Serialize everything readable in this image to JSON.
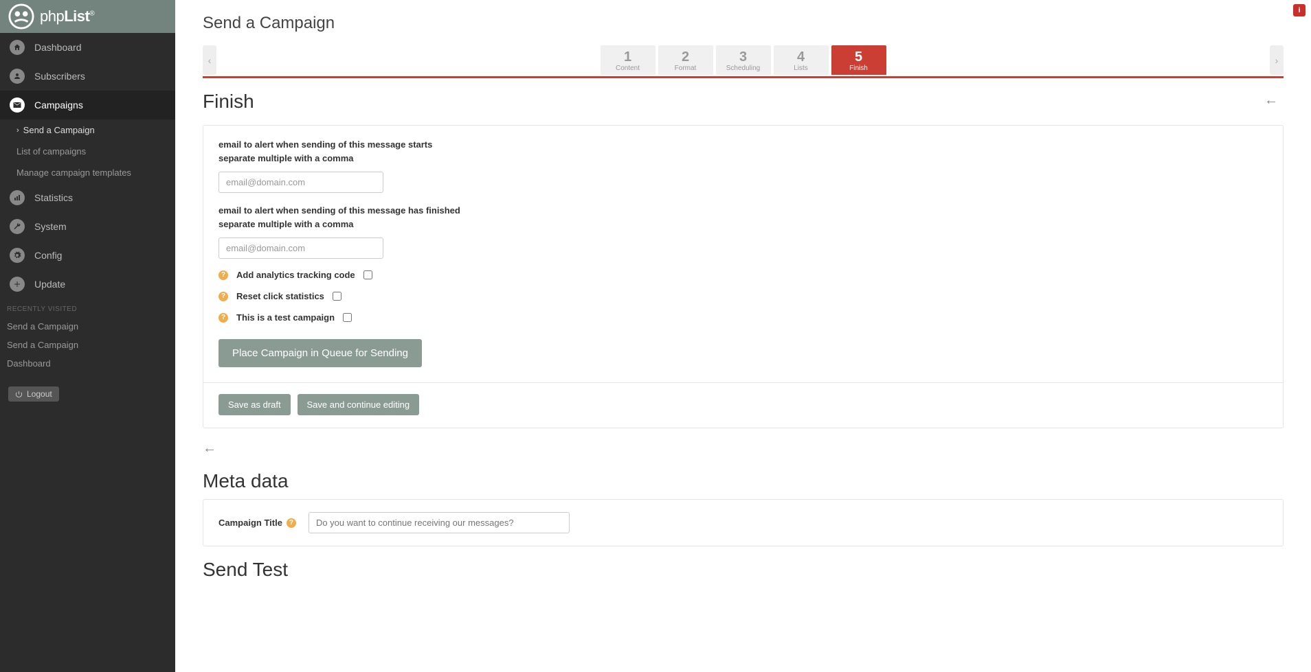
{
  "brand": {
    "name_light": "php",
    "name_bold": "List",
    "reg": "®"
  },
  "infoBadge": "i",
  "sidebar": {
    "items": [
      {
        "label": "Dashboard",
        "icon": "home"
      },
      {
        "label": "Subscribers",
        "icon": "user"
      },
      {
        "label": "Campaigns",
        "icon": "envelope"
      },
      {
        "label": "Statistics",
        "icon": "chart"
      },
      {
        "label": "System",
        "icon": "wrench"
      },
      {
        "label": "Config",
        "icon": "gear"
      },
      {
        "label": "Update",
        "icon": "plus"
      }
    ],
    "sub": [
      {
        "label": "Send a Campaign"
      },
      {
        "label": "List of campaigns"
      },
      {
        "label": "Manage campaign templates"
      }
    ],
    "recentTitle": "RECENTLY VISITED",
    "recent": [
      {
        "label": "Send a Campaign"
      },
      {
        "label": "Send a Campaign"
      },
      {
        "label": "Dashboard"
      }
    ],
    "logout": "Logout"
  },
  "page": {
    "title": "Send a Campaign",
    "wizard": {
      "prev": "‹",
      "next": "›",
      "tabs": [
        {
          "num": "1",
          "label": "Content"
        },
        {
          "num": "2",
          "label": "Format"
        },
        {
          "num": "3",
          "label": "Scheduling"
        },
        {
          "num": "4",
          "label": "Lists"
        },
        {
          "num": "5",
          "label": "Finish"
        }
      ]
    },
    "finish": {
      "heading": "Finish",
      "backArrow": "←",
      "startAlert": {
        "line1": "email to alert when sending of this message starts",
        "line2": "separate multiple with a comma",
        "placeholder": "email@domain.com"
      },
      "endAlert": {
        "line1": "email to alert when sending of this message has finished",
        "line2": "separate multiple with a comma",
        "placeholder": "email@domain.com"
      },
      "checks": {
        "analytics": "Add analytics tracking code",
        "reset": "Reset click statistics",
        "test": "This is a test campaign"
      },
      "queueBtn": "Place Campaign in Queue for Sending",
      "saveDraft": "Save as draft",
      "saveContinue": "Save and continue editing"
    },
    "meta": {
      "heading": "Meta data",
      "titleLabel": "Campaign Title",
      "titlePlaceholder": "Do you want to continue receiving our messages?"
    },
    "sendTest": {
      "heading": "Send Test"
    }
  }
}
